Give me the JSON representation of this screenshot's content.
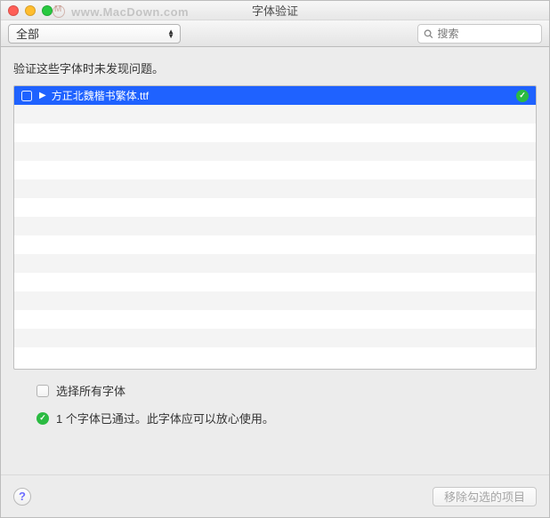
{
  "window": {
    "title": "字体验证"
  },
  "watermark": "www.MacDown.com",
  "toolbar": {
    "filter_selected": "全部",
    "search_placeholder": "搜索"
  },
  "content": {
    "message": "验证这些字体时未发现问题。",
    "items": [
      {
        "name": "方正北魏楷书繁体.ttf",
        "checked": false,
        "status": "pass"
      }
    ],
    "total_rows_visible": 15
  },
  "options": {
    "select_all_label": "选择所有字体",
    "select_all_checked": false,
    "pass_status_text": "1 个字体已通过。此字体应可以放心使用。"
  },
  "footer": {
    "remove_button_label": "移除勾选的项目",
    "remove_button_enabled": false
  }
}
